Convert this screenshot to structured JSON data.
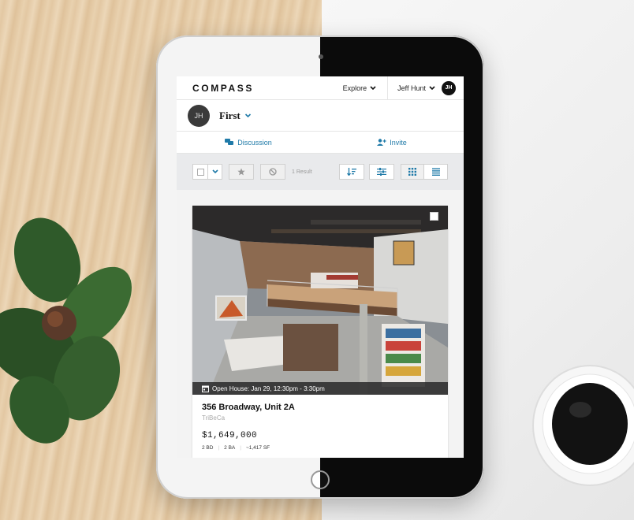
{
  "app": {
    "brand": "COMPASS",
    "explore_label": "Explore",
    "user_name": "Jeff Hunt",
    "user_initials": "JH"
  },
  "collection": {
    "owner_initials": "JH",
    "title": "First"
  },
  "actions": {
    "discussion_label": "Discussion",
    "invite_label": "Invite"
  },
  "toolbar": {
    "results_text": "1 Result"
  },
  "listing": {
    "open_house": "Open House: Jan 29, 12:30pm - 3:30pm",
    "address": "356 Broadway, Unit 2A",
    "neighborhood": "TriBeCa",
    "price": "$1,649,000",
    "beds": "2 BD",
    "baths": "2 BA",
    "sqft": "~1,417 SF"
  },
  "icons": {
    "explore": "chevron-down-icon",
    "user": "chevron-down-icon",
    "title": "chevron-down-icon",
    "discussion": "chat-bubbles-icon",
    "invite": "add-person-icon",
    "favorite": "star-icon",
    "hide": "block-icon",
    "sort": "sort-icon",
    "filter": "sliders-icon",
    "grid_view": "grid-icon",
    "list_view": "list-icon",
    "open_house": "calendar-icon"
  },
  "colors": {
    "accent": "#1f7aa8",
    "toolbar_bg": "#e9eaec",
    "avatar_dark": "#111111"
  }
}
